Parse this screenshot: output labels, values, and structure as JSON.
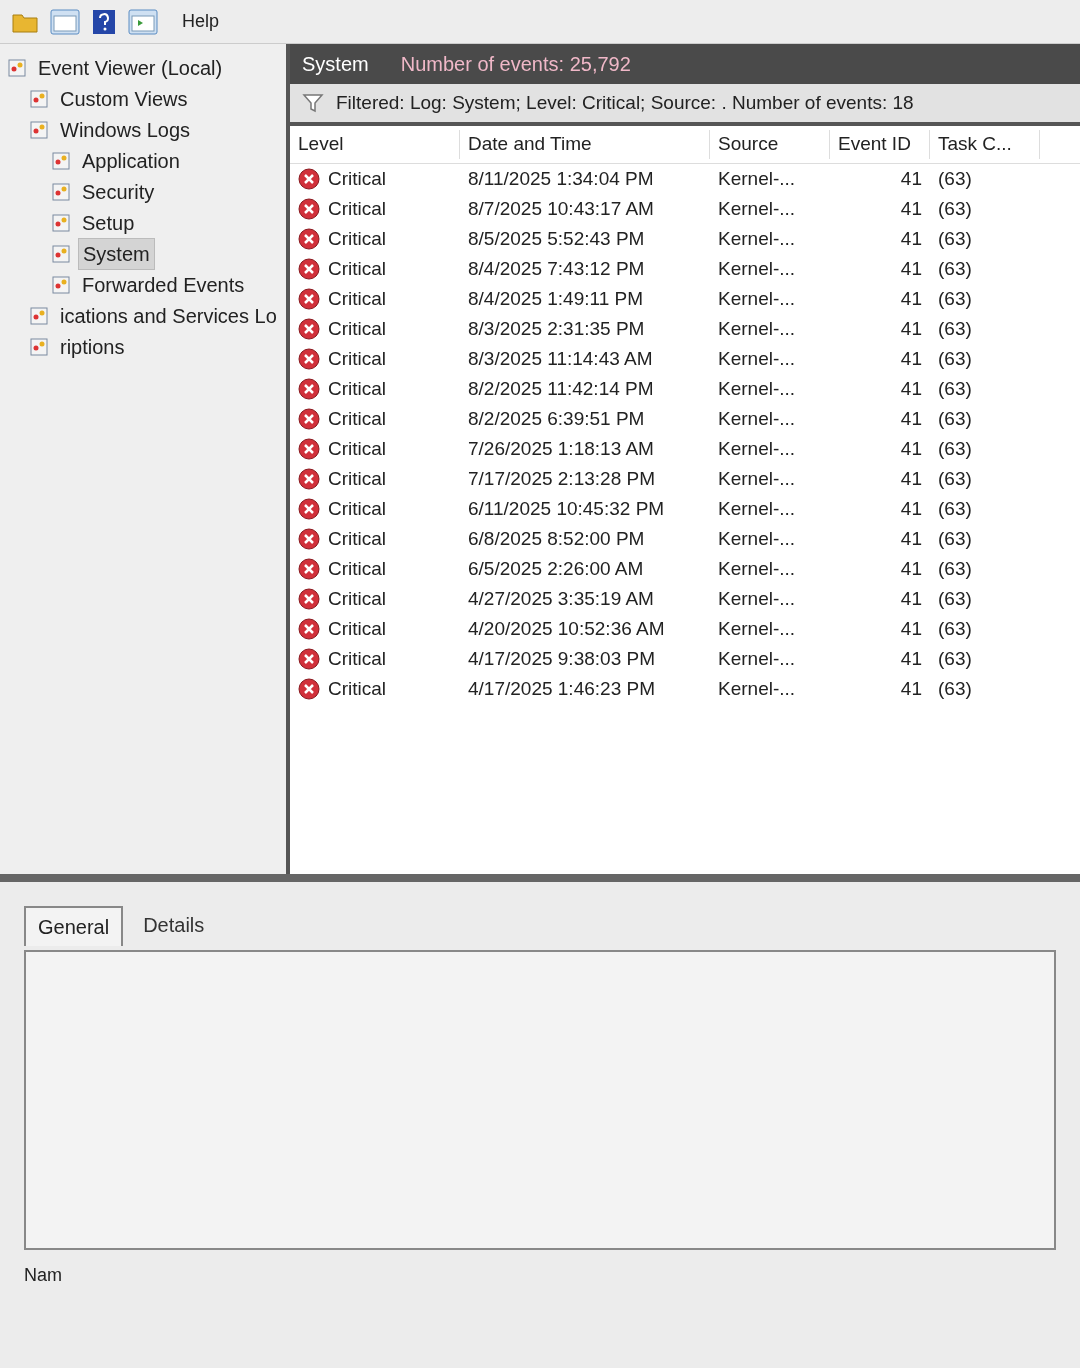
{
  "menu": [
    "Help"
  ],
  "tree": [
    {
      "label": "Event Viewer (Local)",
      "selected": false,
      "children": [
        {
          "label": "Custom Views",
          "selected": false
        },
        {
          "label": "Windows Logs",
          "selected": false,
          "children": [
            {
              "label": "Application",
              "selected": false
            },
            {
              "label": "Security",
              "selected": false
            },
            {
              "label": "Setup",
              "selected": false
            },
            {
              "label": "System",
              "selected": true
            },
            {
              "label": "Forwarded Events",
              "selected": false
            }
          ]
        },
        {
          "label": "ications and Services Lo",
          "selected": false
        },
        {
          "label": "riptions",
          "selected": false
        }
      ]
    }
  ],
  "log_header": {
    "title": "System",
    "count": "Number of events: 25,792"
  },
  "filter_text": "Filtered: Log: System; Level: Critical; Source: . Number of events: 18",
  "table": {
    "columns": [
      "Level",
      "Date and Time",
      "Source",
      "Event ID",
      "Task C..."
    ],
    "rows": [
      [
        "Critical",
        "8/11/2025 1:34:04 PM",
        "Kernel-...",
        "41",
        "(63)"
      ],
      [
        "Critical",
        "8/7/2025 10:43:17 AM",
        "Kernel-...",
        "41",
        "(63)"
      ],
      [
        "Critical",
        "8/5/2025 5:52:43 PM",
        "Kernel-...",
        "41",
        "(63)"
      ],
      [
        "Critical",
        "8/4/2025 7:43:12 PM",
        "Kernel-...",
        "41",
        "(63)"
      ],
      [
        "Critical",
        "8/4/2025 1:49:11 PM",
        "Kernel-...",
        "41",
        "(63)"
      ],
      [
        "Critical",
        "8/3/2025 2:31:35 PM",
        "Kernel-...",
        "41",
        "(63)"
      ],
      [
        "Critical",
        "8/3/2025 11:14:43 AM",
        "Kernel-...",
        "41",
        "(63)"
      ],
      [
        "Critical",
        "8/2/2025 11:42:14 PM",
        "Kernel-...",
        "41",
        "(63)"
      ],
      [
        "Critical",
        "8/2/2025 6:39:51 PM",
        "Kernel-...",
        "41",
        "(63)"
      ],
      [
        "Critical",
        "7/26/2025 1:18:13 AM",
        "Kernel-...",
        "41",
        "(63)"
      ],
      [
        "Critical",
        "7/17/2025 2:13:28 PM",
        "Kernel-...",
        "41",
        "(63)"
      ],
      [
        "Critical",
        "6/11/2025 10:45:32 PM",
        "Kernel-...",
        "41",
        "(63)"
      ],
      [
        "Critical",
        "6/8/2025 8:52:00 PM",
        "Kernel-...",
        "41",
        "(63)"
      ],
      [
        "Critical",
        "6/5/2025 2:26:00 AM",
        "Kernel-...",
        "41",
        "(63)"
      ],
      [
        "Critical",
        "4/27/2025 3:35:19 AM",
        "Kernel-...",
        "41",
        "(63)"
      ],
      [
        "Critical",
        "4/20/2025 10:52:36 AM",
        "Kernel-...",
        "41",
        "(63)"
      ],
      [
        "Critical",
        "4/17/2025 9:38:03 PM",
        "Kernel-...",
        "41",
        "(63)"
      ],
      [
        "Critical",
        "4/17/2025 1:46:23 PM",
        "Kernel-...",
        "41",
        "(63)"
      ]
    ]
  },
  "detail_tabs": [
    {
      "label": "General",
      "selected": true
    },
    {
      "label": "Details",
      "selected": false
    }
  ],
  "detail_footer": "Nam"
}
